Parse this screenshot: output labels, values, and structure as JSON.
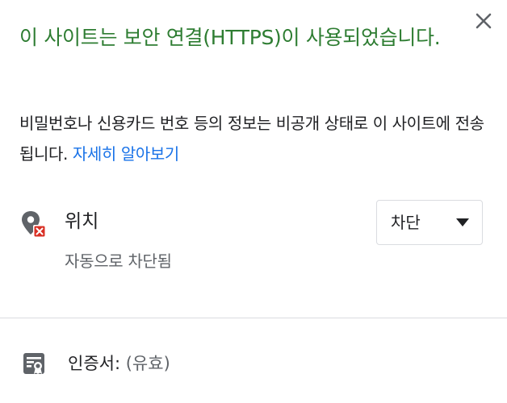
{
  "header": {
    "title": "이 사이트는 보안 연결(HTTPS)이 사용되었습니다.",
    "close_icon": "close-icon"
  },
  "description": {
    "text": "비밀번호나 신용카드 번호 등의 정보는 비공개 상태로 이 사이트에 전송됩니다. ",
    "link": "자세히 알아보기",
    "link_color": "#1a73e8"
  },
  "permissions": {
    "location": {
      "icon": "location-blocked-icon",
      "label": "위치",
      "sublabel": "자동으로 차단됨",
      "select_value": "차단"
    }
  },
  "certificate": {
    "icon": "certificate-icon",
    "label": "인증서:",
    "value": "(유효)"
  },
  "colors": {
    "title": "#2e7d32",
    "block_badge": "#d93025"
  }
}
